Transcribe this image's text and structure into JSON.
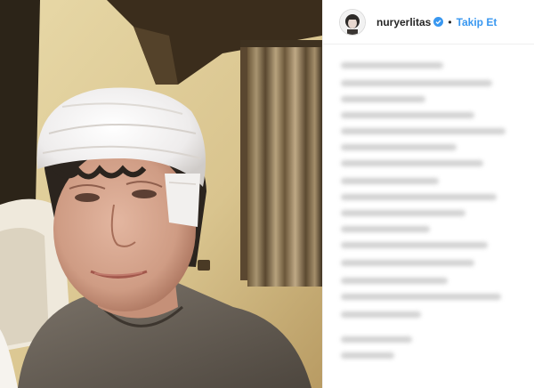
{
  "post": {
    "username": "nuryerlitas",
    "separator": "•",
    "follow_label": "Takip Et"
  },
  "colors": {
    "accent": "#3897f0",
    "verified": "#3897f0",
    "username": "#262626"
  },
  "icons": {
    "verified": "verified-badge-icon",
    "avatar": "profile-avatar"
  }
}
